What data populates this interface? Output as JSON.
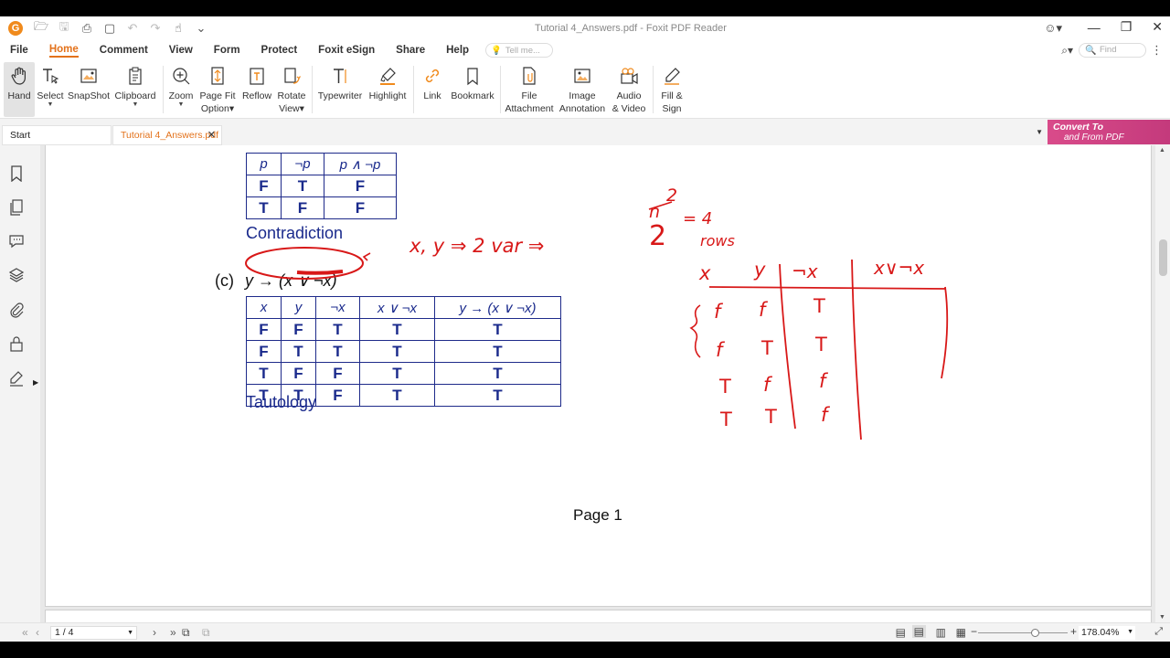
{
  "window": {
    "title": "Tutorial 4_Answers.pdf - Foxit PDF Reader",
    "logo_letter": "G"
  },
  "menu": {
    "items": [
      "File",
      "Home",
      "Comment",
      "View",
      "Form",
      "Protect",
      "Foxit eSign",
      "Share",
      "Help"
    ],
    "active": "Home",
    "tell_me_placeholder": "Tell me...",
    "find_placeholder": "Find"
  },
  "ribbon": {
    "hand": "Hand",
    "select": "Select",
    "snapshot": "SnapShot",
    "clipboard": "Clipboard",
    "zoom": "Zoom",
    "page_fit_1": "Page Fit",
    "page_fit_2": "Option",
    "reflow": "Reflow",
    "rotate_1": "Rotate",
    "rotate_2": "View",
    "typewriter": "Typewriter",
    "highlight": "Highlight",
    "link": "Link",
    "bookmark": "Bookmark",
    "file_att_1": "File",
    "file_att_2": "Attachment",
    "image_ann_1": "Image",
    "image_ann_2": "Annotation",
    "audio_1": "Audio",
    "audio_2": "& Video",
    "fill_1": "Fill &",
    "fill_2": "Sign"
  },
  "tabs": {
    "start": "Start",
    "current": "Tutorial 4_Answers.pdf",
    "convert_1": "Convert To",
    "convert_2": "and From PDF"
  },
  "document": {
    "table1": {
      "headers": [
        "p",
        "¬p",
        "p ∧ ¬p"
      ],
      "rows": [
        [
          "F",
          "T",
          "F"
        ],
        [
          "T",
          "F",
          "F"
        ]
      ]
    },
    "label1": "Contradiction",
    "part_label": "(c)",
    "formula": "y → (x ∨ ¬x)",
    "table2": {
      "headers": [
        "x",
        "y",
        "¬x",
        "x ∨ ¬x",
        "y → (x ∨ ¬x)"
      ],
      "rows": [
        [
          "F",
          "F",
          "T",
          "T",
          "T"
        ],
        [
          "F",
          "T",
          "T",
          "T",
          "T"
        ],
        [
          "T",
          "F",
          "F",
          "T",
          "T"
        ],
        [
          "T",
          "T",
          "F",
          "T",
          "T"
        ]
      ]
    },
    "label2": "Tautology",
    "page_label": "Page 1"
  },
  "handwriting": {
    "vars_note": "x, y ⇒ 2 var ⇒",
    "big_two": "2",
    "exp_top": "2",
    "exp_n": "n",
    "exp_eq": "= 4",
    "rows_word": "rows",
    "col_x": "x",
    "col_y": "y",
    "col_nx": "¬x",
    "col_or": "x∨¬x",
    "col_x_vals": [
      "f",
      "f",
      "T",
      "T"
    ],
    "col_y_vals": [
      "f",
      "T",
      "f",
      "T"
    ],
    "col_nx_vals": [
      "T",
      "T",
      "f",
      "f"
    ]
  },
  "status": {
    "page_indicator": "1 / 4",
    "zoom": "178.04%"
  },
  "colors": {
    "accent": "#e3721b",
    "table_blue": "#1a2a8c",
    "ink_red": "#d81818",
    "convert_bg": "#c43a7c"
  }
}
